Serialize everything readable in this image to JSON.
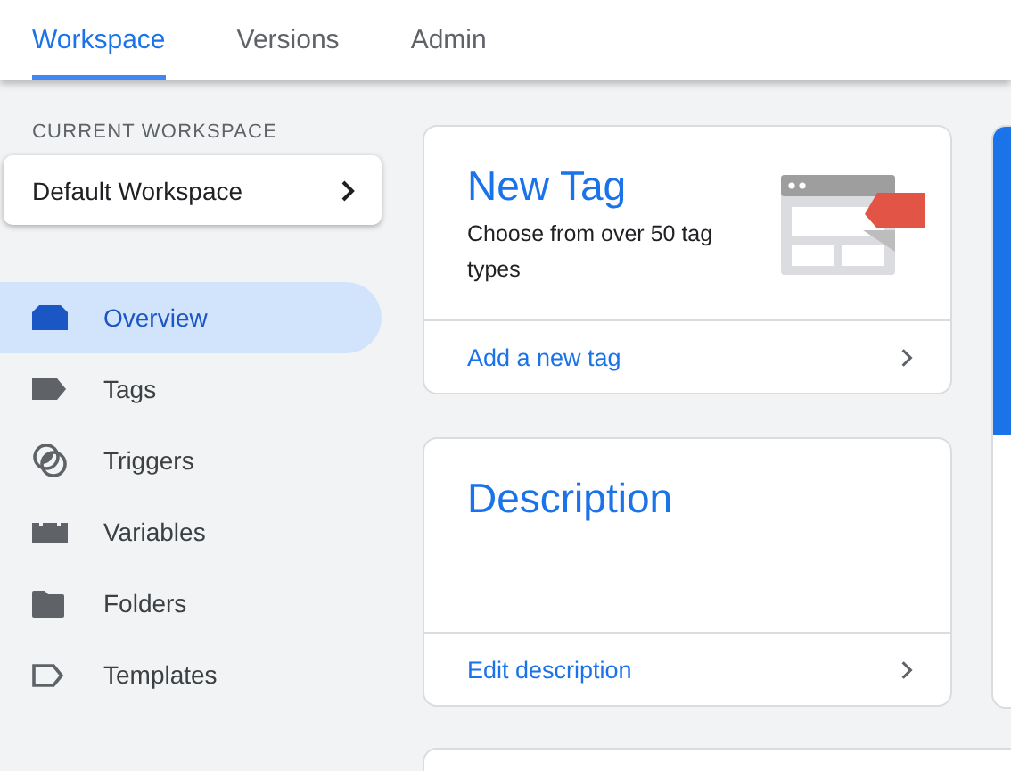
{
  "tabs": [
    {
      "label": "Workspace",
      "selected": true
    },
    {
      "label": "Versions",
      "selected": false
    },
    {
      "label": "Admin",
      "selected": false
    }
  ],
  "sidebar": {
    "section_label": "CURRENT WORKSPACE",
    "workspace": "Default Workspace",
    "items": [
      {
        "label": "Overview",
        "selected": true
      },
      {
        "label": "Tags",
        "selected": false
      },
      {
        "label": "Triggers",
        "selected": false
      },
      {
        "label": "Variables",
        "selected": false
      },
      {
        "label": "Folders",
        "selected": false
      },
      {
        "label": "Templates",
        "selected": false
      }
    ]
  },
  "cards": [
    {
      "title": "New Tag",
      "text": "Choose from over 50 tag types",
      "link": "Add a new tag"
    },
    {
      "title": "Description",
      "link": "Edit description"
    }
  ]
}
